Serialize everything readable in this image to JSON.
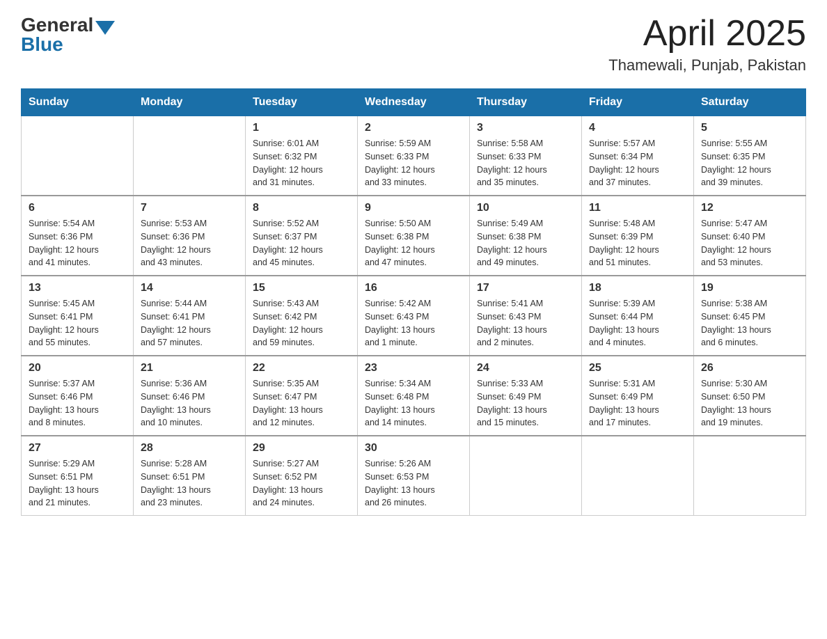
{
  "logo": {
    "general": "General",
    "blue": "Blue"
  },
  "title": {
    "month_year": "April 2025",
    "location": "Thamewali, Punjab, Pakistan"
  },
  "headers": [
    "Sunday",
    "Monday",
    "Tuesday",
    "Wednesday",
    "Thursday",
    "Friday",
    "Saturday"
  ],
  "weeks": [
    [
      {
        "day": "",
        "info": ""
      },
      {
        "day": "",
        "info": ""
      },
      {
        "day": "1",
        "info": "Sunrise: 6:01 AM\nSunset: 6:32 PM\nDaylight: 12 hours\nand 31 minutes."
      },
      {
        "day": "2",
        "info": "Sunrise: 5:59 AM\nSunset: 6:33 PM\nDaylight: 12 hours\nand 33 minutes."
      },
      {
        "day": "3",
        "info": "Sunrise: 5:58 AM\nSunset: 6:33 PM\nDaylight: 12 hours\nand 35 minutes."
      },
      {
        "day": "4",
        "info": "Sunrise: 5:57 AM\nSunset: 6:34 PM\nDaylight: 12 hours\nand 37 minutes."
      },
      {
        "day": "5",
        "info": "Sunrise: 5:55 AM\nSunset: 6:35 PM\nDaylight: 12 hours\nand 39 minutes."
      }
    ],
    [
      {
        "day": "6",
        "info": "Sunrise: 5:54 AM\nSunset: 6:36 PM\nDaylight: 12 hours\nand 41 minutes."
      },
      {
        "day": "7",
        "info": "Sunrise: 5:53 AM\nSunset: 6:36 PM\nDaylight: 12 hours\nand 43 minutes."
      },
      {
        "day": "8",
        "info": "Sunrise: 5:52 AM\nSunset: 6:37 PM\nDaylight: 12 hours\nand 45 minutes."
      },
      {
        "day": "9",
        "info": "Sunrise: 5:50 AM\nSunset: 6:38 PM\nDaylight: 12 hours\nand 47 minutes."
      },
      {
        "day": "10",
        "info": "Sunrise: 5:49 AM\nSunset: 6:38 PM\nDaylight: 12 hours\nand 49 minutes."
      },
      {
        "day": "11",
        "info": "Sunrise: 5:48 AM\nSunset: 6:39 PM\nDaylight: 12 hours\nand 51 minutes."
      },
      {
        "day": "12",
        "info": "Sunrise: 5:47 AM\nSunset: 6:40 PM\nDaylight: 12 hours\nand 53 minutes."
      }
    ],
    [
      {
        "day": "13",
        "info": "Sunrise: 5:45 AM\nSunset: 6:41 PM\nDaylight: 12 hours\nand 55 minutes."
      },
      {
        "day": "14",
        "info": "Sunrise: 5:44 AM\nSunset: 6:41 PM\nDaylight: 12 hours\nand 57 minutes."
      },
      {
        "day": "15",
        "info": "Sunrise: 5:43 AM\nSunset: 6:42 PM\nDaylight: 12 hours\nand 59 minutes."
      },
      {
        "day": "16",
        "info": "Sunrise: 5:42 AM\nSunset: 6:43 PM\nDaylight: 13 hours\nand 1 minute."
      },
      {
        "day": "17",
        "info": "Sunrise: 5:41 AM\nSunset: 6:43 PM\nDaylight: 13 hours\nand 2 minutes."
      },
      {
        "day": "18",
        "info": "Sunrise: 5:39 AM\nSunset: 6:44 PM\nDaylight: 13 hours\nand 4 minutes."
      },
      {
        "day": "19",
        "info": "Sunrise: 5:38 AM\nSunset: 6:45 PM\nDaylight: 13 hours\nand 6 minutes."
      }
    ],
    [
      {
        "day": "20",
        "info": "Sunrise: 5:37 AM\nSunset: 6:46 PM\nDaylight: 13 hours\nand 8 minutes."
      },
      {
        "day": "21",
        "info": "Sunrise: 5:36 AM\nSunset: 6:46 PM\nDaylight: 13 hours\nand 10 minutes."
      },
      {
        "day": "22",
        "info": "Sunrise: 5:35 AM\nSunset: 6:47 PM\nDaylight: 13 hours\nand 12 minutes."
      },
      {
        "day": "23",
        "info": "Sunrise: 5:34 AM\nSunset: 6:48 PM\nDaylight: 13 hours\nand 14 minutes."
      },
      {
        "day": "24",
        "info": "Sunrise: 5:33 AM\nSunset: 6:49 PM\nDaylight: 13 hours\nand 15 minutes."
      },
      {
        "day": "25",
        "info": "Sunrise: 5:31 AM\nSunset: 6:49 PM\nDaylight: 13 hours\nand 17 minutes."
      },
      {
        "day": "26",
        "info": "Sunrise: 5:30 AM\nSunset: 6:50 PM\nDaylight: 13 hours\nand 19 minutes."
      }
    ],
    [
      {
        "day": "27",
        "info": "Sunrise: 5:29 AM\nSunset: 6:51 PM\nDaylight: 13 hours\nand 21 minutes."
      },
      {
        "day": "28",
        "info": "Sunrise: 5:28 AM\nSunset: 6:51 PM\nDaylight: 13 hours\nand 23 minutes."
      },
      {
        "day": "29",
        "info": "Sunrise: 5:27 AM\nSunset: 6:52 PM\nDaylight: 13 hours\nand 24 minutes."
      },
      {
        "day": "30",
        "info": "Sunrise: 5:26 AM\nSunset: 6:53 PM\nDaylight: 13 hours\nand 26 minutes."
      },
      {
        "day": "",
        "info": ""
      },
      {
        "day": "",
        "info": ""
      },
      {
        "day": "",
        "info": ""
      }
    ]
  ]
}
